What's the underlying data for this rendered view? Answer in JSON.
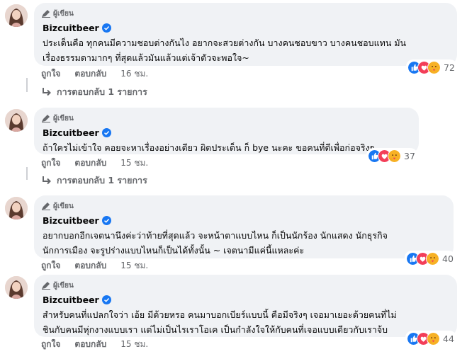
{
  "colors": {
    "bubble": "#f0f2f5",
    "meta": "#65676b",
    "verified": "#1877f2",
    "like": "#1877f2",
    "love": "#f33e58",
    "care": "#f7b125"
  },
  "author_badge_icon": "pen-icon",
  "comments": [
    {
      "badge": "ผู้เขียน",
      "name": "Bizcuitbeer",
      "lines": [
        "ประเด็นคือ ทุกคนมีความชอบต่างกันไง อยากจะสวยต่างกัน บางคนชอบขาว บางคนชอบแทน มัน",
        "เรื่องธรรมดามากๆ ที่สุดแล้วมันแล้วแต่เจ้าตัวจะพอใจ~"
      ],
      "like": "ถูกใจ",
      "reply": "ตอบกลับ",
      "time": "16 ชม.",
      "reaction_count": "72",
      "replies_label": "การตอบกลับ 1 รายการ"
    },
    {
      "badge": "ผู้เขียน",
      "name": "Bizcuitbeer",
      "lines": [
        "ถ้าใครไม่เข้าใจ คอยจะหาเรื่องอย่างเดียว ผิดประเด็น ก็ bye นะคะ ขอคนที่ดีเพื่อก่อจริงๆ"
      ],
      "like": "ถูกใจ",
      "reply": "ตอบกลับ",
      "time": "15 ชม.",
      "reaction_count": "37",
      "replies_label": "การตอบกลับ 1 รายการ"
    },
    {
      "badge": "ผู้เขียน",
      "name": "Bizcuitbeer",
      "lines": [
        "อยากบอกอีกเจตนานึงค่ะว่าท้ายที่สุดแล้ว จะหน้าตาแบบไหน ก็เป็นนักร้อง นักแสดง นักธุรกิจ",
        "นักการเมือง จะรูปร่างแบบไหนก็เป็นได้ทั้งนั้น ~ เจตนามีแค่นี้แหละค่ะ"
      ],
      "like": "ถูกใจ",
      "reply": "ตอบกลับ",
      "time": "15 ชม.",
      "reaction_count": "40"
    },
    {
      "badge": "ผู้เขียน",
      "name": "Bizcuitbeer",
      "lines": [
        "สำหรับคนที่แปลกใจว่า เอ้ย มีด้วยหรอ คนมาบอกเบียร์แบบนี้ คือมีจริงๆ เจอมาเยอะด้วยคนที่ไม่",
        "ชินกับคนมีหุ่กงางแบบเรา แต่ไม่เป็นไรเราโอเค เป็นกำลังใจให้กับคนที่เจอแบบเดียวกับเราจ้บ"
      ],
      "like": "ถูกใจ",
      "reply": "ตอบกลับ",
      "time": "15 ชม.",
      "reaction_count": "44"
    }
  ]
}
